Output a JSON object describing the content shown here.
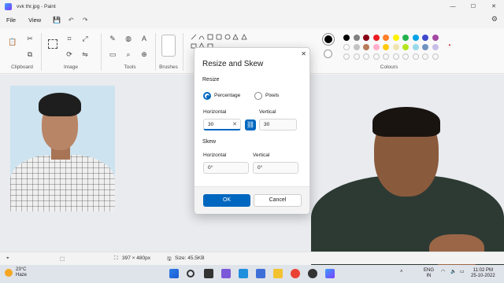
{
  "window": {
    "title": "vvk thr.jpg - Paint",
    "minimize": "—",
    "maximize": "☐",
    "close": "✕"
  },
  "menu": {
    "file": "File",
    "view": "View",
    "save_icon": "save-icon",
    "undo_icon": "undo-icon",
    "redo_icon": "redo-icon"
  },
  "ribbon": {
    "groups": {
      "clipboard": "Clipboard",
      "image": "Image",
      "tools": "Tools",
      "brushes": "Brushes",
      "colors": "Colours"
    }
  },
  "colors": {
    "primary": "#000000",
    "secondary": "#ffffff",
    "palette_row1": [
      "#000000",
      "#7f7f7f",
      "#880015",
      "#ed1c24",
      "#ff7f27",
      "#fff200",
      "#22b14c",
      "#00a2e8",
      "#3f48cc",
      "#a349a4"
    ],
    "palette_row2": [
      "#ffffff",
      "#c3c3c3",
      "#b97a57",
      "#ffaec9",
      "#ffc90e",
      "#efe4b0",
      "#b5e61d",
      "#99d9ea",
      "#7092be",
      "#c8bfe7"
    ]
  },
  "dialog": {
    "title": "Resize and Skew",
    "close_label": "✕",
    "resize_section": "Resize",
    "percentage_label": "Percentage",
    "pixels_label": "Pixels",
    "selected_unit": "Percentage",
    "horizontal_label": "Horizontal",
    "vertical_label": "Vertical",
    "horizontal_value": "30",
    "vertical_value": "30",
    "clear_glyph": "✕",
    "link_glyph": "⛓",
    "skew_section": "Skew",
    "skew_horizontal_label": "Horizontal",
    "skew_vertical_label": "Vertical",
    "skew_horizontal_value": "0°",
    "skew_vertical_value": "0°",
    "ok_label": "OK",
    "cancel_label": "Cancel"
  },
  "status": {
    "dimensions": "397 × 480px",
    "size": "Size: 45.5KB"
  },
  "taskbar": {
    "weather_temp": "23°C",
    "weather_desc": "Haze",
    "language_line1": "ENG",
    "language_line2": "IN",
    "time": "11:02 PM",
    "date": "25-10-2022"
  }
}
